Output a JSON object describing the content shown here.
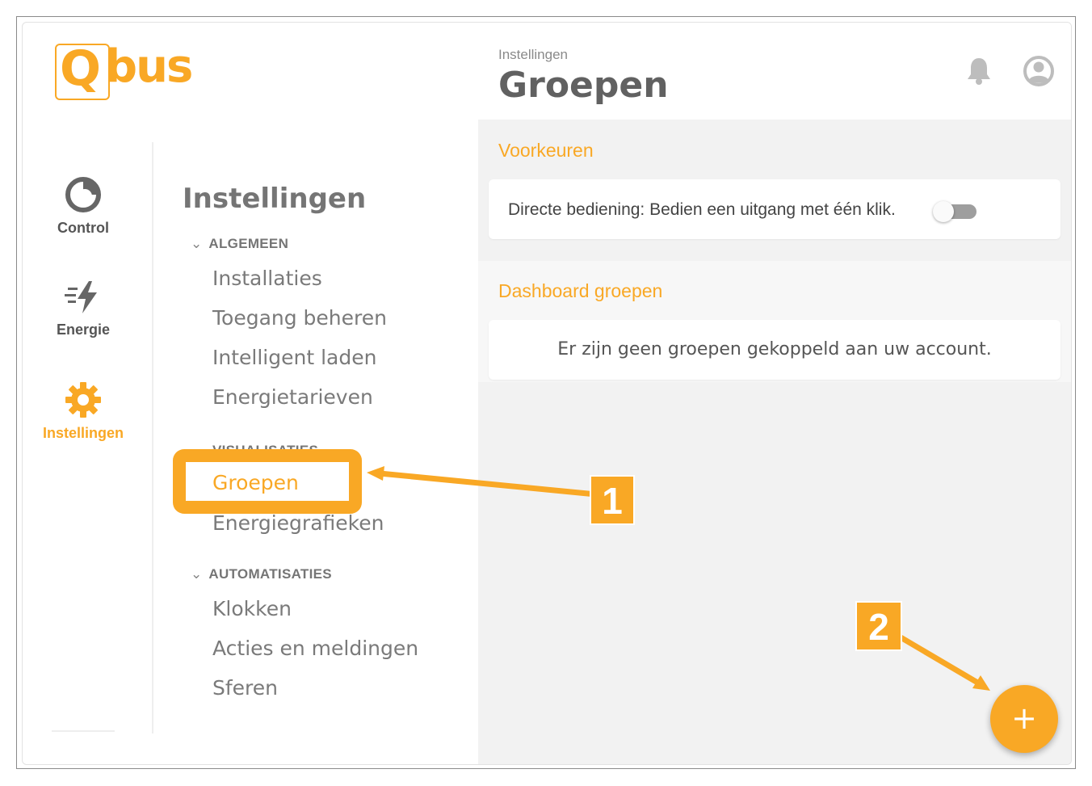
{
  "brand": {
    "logo_text": "Qbus",
    "accent_color": "#f9a825"
  },
  "nav": {
    "items": [
      {
        "icon": "control-icon",
        "label": "Control",
        "active": false
      },
      {
        "icon": "energy-bolt-icon",
        "label": "Energie",
        "active": false
      },
      {
        "icon": "gear-icon",
        "label": "Instellingen",
        "active": true
      }
    ]
  },
  "menu": {
    "title": "Instellingen",
    "sections": [
      {
        "label": "ALGEMEEN",
        "items": [
          "Installaties",
          "Toegang beheren",
          "Intelligent laden",
          "Energietarieven"
        ]
      },
      {
        "label": "VISUALISATIES",
        "items": [
          "Groepen",
          "Energiegrafieken"
        ]
      },
      {
        "label": "AUTOMATISATIES",
        "items": [
          "Klokken",
          "Acties en meldingen",
          "Sferen"
        ]
      }
    ],
    "active_item": "Groepen"
  },
  "header": {
    "breadcrumb": "Instellingen",
    "title": "Groepen"
  },
  "preferences": {
    "heading": "Voorkeuren",
    "direct_control_label": "Directe bediening: Bedien een uitgang met één klik.",
    "direct_control_enabled": false
  },
  "dashboard_groups": {
    "heading": "Dashboard groepen",
    "empty_message": "Er zijn geen groepen gekoppeld aan uw account."
  },
  "fab": {
    "label": "+"
  },
  "annotations": {
    "callout_1": "1",
    "callout_2": "2"
  }
}
